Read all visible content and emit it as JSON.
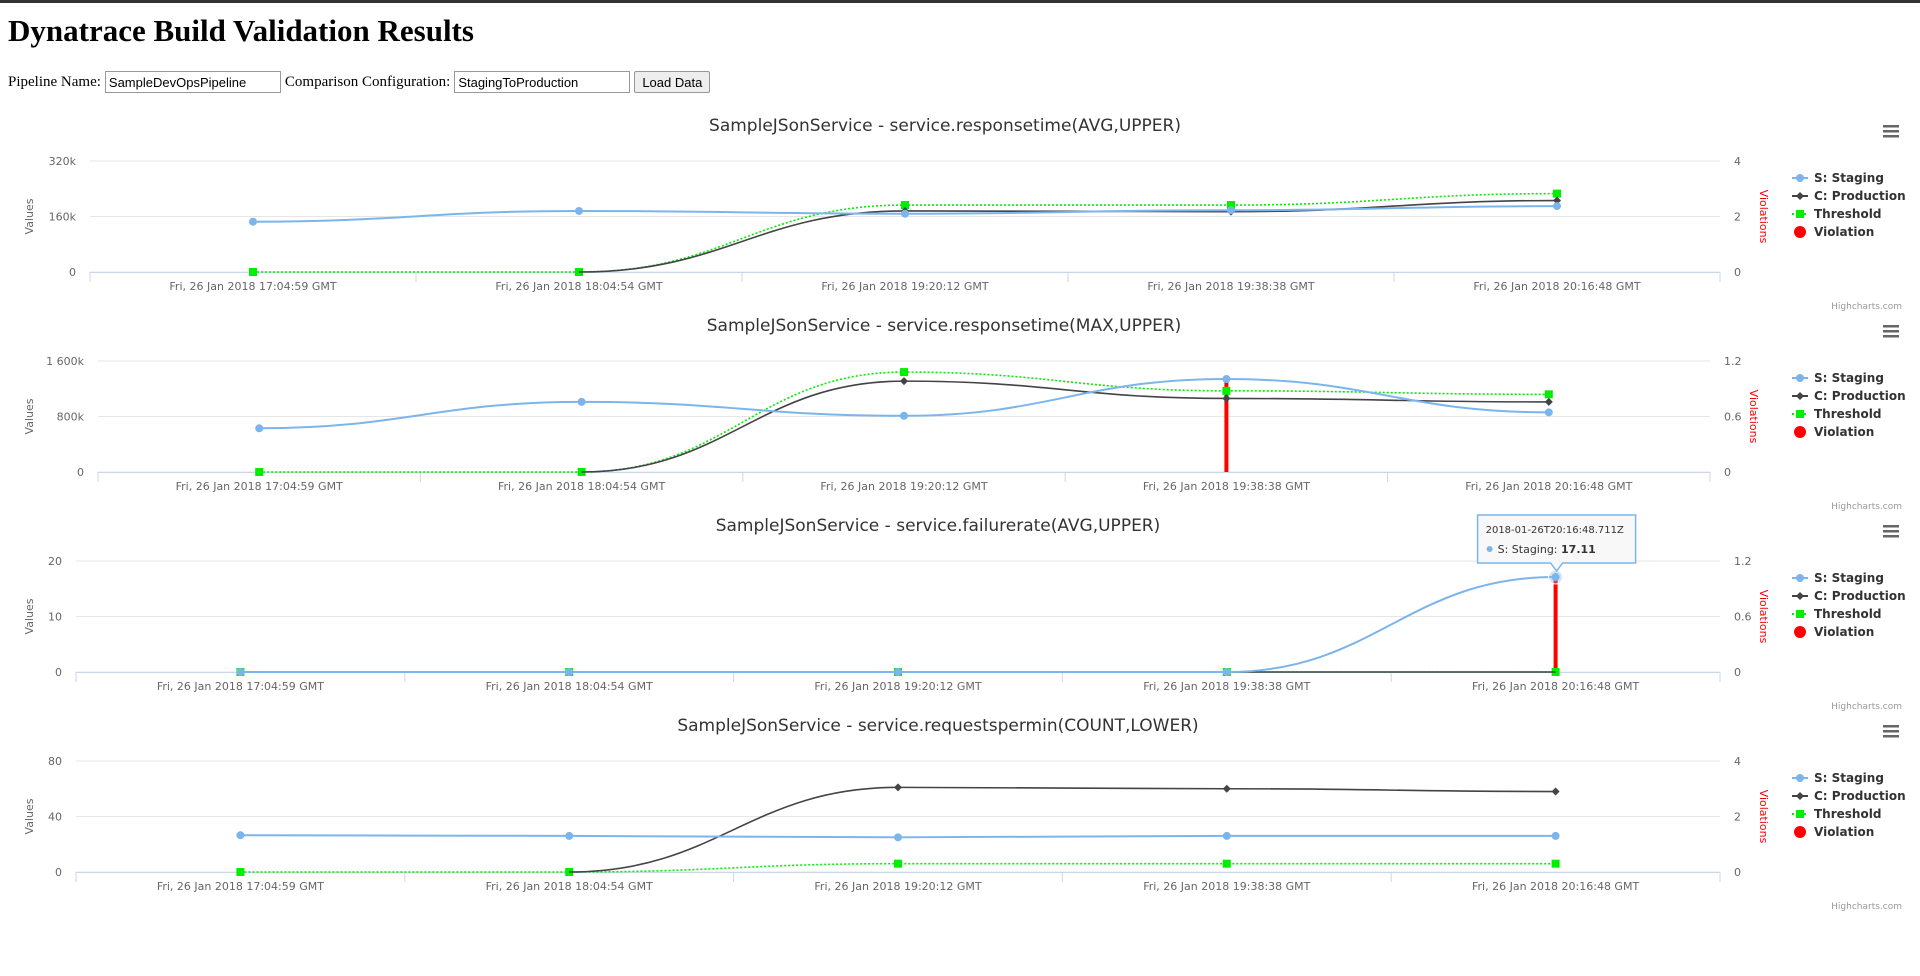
{
  "page": {
    "title": "Dynatrace Build Validation Results",
    "pipeline_label": "Pipeline Name:",
    "pipeline_value": "SampleDevOpsPipeline",
    "comparison_label": "Comparison Configuration:",
    "comparison_value": "StagingToProduction",
    "load_button": "Load Data"
  },
  "legend": [
    {
      "name": "S: Staging",
      "color": "#7cb5ec",
      "marker": "circle"
    },
    {
      "name": "C: Production",
      "color": "#434348",
      "marker": "diamond"
    },
    {
      "name": "Threshold",
      "color": "#00ee00",
      "marker": "square"
    },
    {
      "name": "Violation",
      "color": "#ff0000",
      "marker": "bigcircle"
    }
  ],
  "credit": "Highcharts.com",
  "colors": {
    "staging": "#7cb5ec",
    "production": "#434348",
    "threshold": "#00ee00",
    "violation": "#ff0000"
  },
  "chart_data": [
    {
      "type": "line",
      "title": "SampleJSonService - service.responsetime(AVG,UPPER)",
      "ylabel": "Values",
      "y2label": "Violations",
      "categories": [
        "Fri, 26 Jan 2018 17:04:59 GMT",
        "Fri, 26 Jan 2018 18:04:54 GMT",
        "Fri, 26 Jan 2018 19:20:12 GMT",
        "Fri, 26 Jan 2018 19:38:38 GMT",
        "Fri, 26 Jan 2018 20:16:48 GMT"
      ],
      "yticks": [
        0,
        160000,
        320000
      ],
      "ytick_labels": [
        "0",
        "160k",
        "320k"
      ],
      "ylim": [
        0,
        320000
      ],
      "y2ticks": [
        0,
        2,
        4
      ],
      "y2lim": [
        0,
        4
      ],
      "series": [
        {
          "name": "S: Staging",
          "values": [
            145000,
            176000,
            168000,
            178000,
            190000
          ]
        },
        {
          "name": "C: Production",
          "values": [
            null,
            0,
            176000,
            174000,
            206000
          ]
        },
        {
          "name": "Threshold",
          "values": [
            0,
            0,
            193000,
            193000,
            226000
          ]
        }
      ],
      "violations": [
        0,
        0,
        0,
        0,
        0
      ]
    },
    {
      "type": "line",
      "title": "SampleJSonService - service.responsetime(MAX,UPPER)",
      "ylabel": "Values",
      "y2label": "Violations",
      "categories": [
        "Fri, 26 Jan 2018 17:04:59 GMT",
        "Fri, 26 Jan 2018 18:04:54 GMT",
        "Fri, 26 Jan 2018 19:20:12 GMT",
        "Fri, 26 Jan 2018 19:38:38 GMT",
        "Fri, 26 Jan 2018 20:16:48 GMT"
      ],
      "yticks": [
        0,
        800000,
        1600000
      ],
      "ytick_labels": [
        "0",
        "800k",
        "1 600k"
      ],
      "ylim": [
        0,
        1600000
      ],
      "y2ticks": [
        0,
        0.6,
        1.2
      ],
      "y2lim": [
        0,
        1.2
      ],
      "series": [
        {
          "name": "S: Staging",
          "values": [
            630000,
            1010000,
            810000,
            1340000,
            860000
          ]
        },
        {
          "name": "C: Production",
          "values": [
            null,
            0,
            1310000,
            1060000,
            1010000
          ]
        },
        {
          "name": "Threshold",
          "values": [
            0,
            0,
            1440000,
            1170000,
            1120000
          ]
        }
      ],
      "violations": [
        0,
        0,
        0,
        1,
        0
      ]
    },
    {
      "type": "line",
      "title": "SampleJSonService - service.failurerate(AVG,UPPER)",
      "ylabel": "Values",
      "y2label": "Violations",
      "categories": [
        "Fri, 26 Jan 2018 17:04:59 GMT",
        "Fri, 26 Jan 2018 18:04:54 GMT",
        "Fri, 26 Jan 2018 19:20:12 GMT",
        "Fri, 26 Jan 2018 19:38:38 GMT",
        "Fri, 26 Jan 2018 20:16:48 GMT"
      ],
      "yticks": [
        0,
        10,
        20
      ],
      "ytick_labels": [
        "0",
        "10",
        "20"
      ],
      "ylim": [
        0,
        20
      ],
      "y2ticks": [
        0,
        0.6,
        1.2
      ],
      "y2lim": [
        0,
        1.2
      ],
      "series": [
        {
          "name": "S: Staging",
          "values": [
            0,
            0,
            0,
            0,
            17.11
          ]
        },
        {
          "name": "C: Production",
          "values": [
            0,
            0,
            0,
            0,
            0
          ]
        },
        {
          "name": "Threshold",
          "values": [
            0,
            0,
            0,
            0,
            0
          ]
        }
      ],
      "violations": [
        0,
        0,
        0,
        0,
        1
      ],
      "tooltip": {
        "point_index": 4,
        "time": "2018-01-26T20:16:48.711Z",
        "series": "S: Staging",
        "label": "S: Staging:",
        "value": "17.11"
      }
    },
    {
      "type": "line",
      "title": "SampleJSonService - service.requestspermin(COUNT,LOWER)",
      "ylabel": "Values",
      "y2label": "Violations",
      "categories": [
        "Fri, 26 Jan 2018 17:04:59 GMT",
        "Fri, 26 Jan 2018 18:04:54 GMT",
        "Fri, 26 Jan 2018 19:20:12 GMT",
        "Fri, 26 Jan 2018 19:38:38 GMT",
        "Fri, 26 Jan 2018 20:16:48 GMT"
      ],
      "yticks": [
        0,
        40,
        80
      ],
      "ytick_labels": [
        "0",
        "40",
        "80"
      ],
      "ylim": [
        0,
        80
      ],
      "y2ticks": [
        0,
        2,
        4
      ],
      "y2lim": [
        0,
        4
      ],
      "series": [
        {
          "name": "S: Staging",
          "values": [
            26.5,
            26,
            25,
            26,
            26
          ]
        },
        {
          "name": "C: Production",
          "values": [
            null,
            0,
            61,
            60,
            58
          ]
        },
        {
          "name": "Threshold",
          "values": [
            0,
            0,
            6,
            6,
            6
          ]
        }
      ],
      "violations": [
        0,
        0,
        0,
        0,
        0
      ]
    }
  ]
}
